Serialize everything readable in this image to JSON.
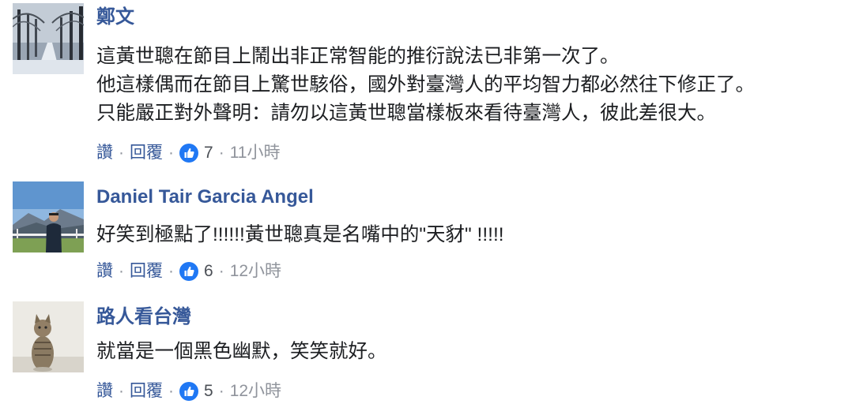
{
  "ui": {
    "like_label": "讚",
    "reply_label": "回覆",
    "separator": "·"
  },
  "comments": [
    {
      "author": "鄭文",
      "lines": [
        "這黃世聰在節目上鬧出非正常智能的推衍說法已非第一次了。",
        "他這樣偶而在節目上驚世駭俗，國外對臺灣人的平均智力都必然往下修正了。",
        "只能嚴正對外聲明：請勿以這黃世聰當樣板來看待臺灣人，彼此差很大。"
      ],
      "likes": "7",
      "time": "11小時"
    },
    {
      "author": "Daniel Tair Garcia Angel",
      "lines": [
        "好笑到極點了!!!!!!黃世聰真是名嘴中的\"天豺\" !!!!!"
      ],
      "likes": "6",
      "time": "12小時"
    },
    {
      "author": "路人看台灣",
      "lines": [
        "就當是一個黑色幽默，笑笑就好。"
      ],
      "likes": "5",
      "time": "12小時"
    }
  ],
  "colors": {
    "author": "#365899",
    "text": "#1c1e21",
    "meta": "#90949c",
    "like_badge": "#2078f4"
  },
  "icons": {
    "reaction": "thumbs-up-icon"
  }
}
